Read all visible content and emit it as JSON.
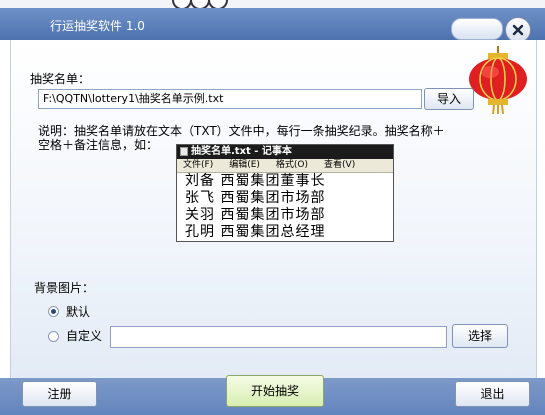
{
  "window": {
    "title": "行运抽奖软件 1.0"
  },
  "list_section": {
    "label": "抽奖名单：",
    "file_path": "F:\\QQTN\\lottery1\\抽奖名单示例.txt",
    "import_label": "导入",
    "help_line1": "说明：抽奖名单请放在文本（TXT）文件中，每行一条抽奖纪录。抽奖名称＋",
    "help_line2": "空格＋备注信息，如："
  },
  "sample": {
    "title": "抽奖名单.txt - 记事本",
    "menu": [
      "文件(F)",
      "编辑(E)",
      "格式(O)",
      "查看(V)"
    ],
    "lines": [
      "刘备 西蜀集团董事长",
      "张飞 西蜀集团市场部",
      "关羽 西蜀集团市场部",
      "孔明 西蜀集团总经理"
    ]
  },
  "background_section": {
    "label": "背景图片：",
    "default_label": "默认",
    "custom_label": "自定义",
    "custom_value": "",
    "choose_label": "选择",
    "selected": "默认"
  },
  "footer": {
    "register_label": "注册",
    "start_label": "开始抽奖",
    "exit_label": "退出"
  },
  "colors": {
    "titlebar": "#5a7fba",
    "lantern": "#e02020",
    "start_button": "#e6f5c8"
  }
}
